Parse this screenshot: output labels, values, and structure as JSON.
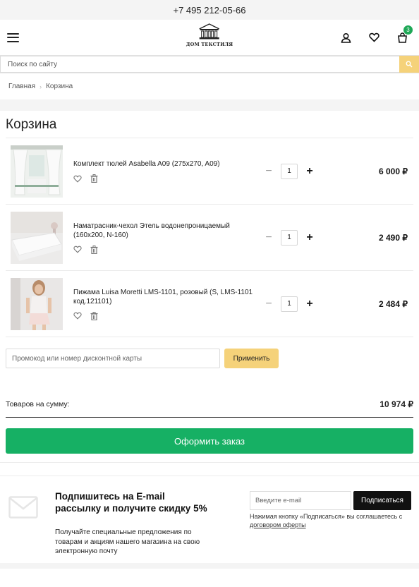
{
  "topbar": {
    "phone": "+7 495 212-05-66"
  },
  "header": {
    "logo_text": "ДОМ ТЕКСТИЛЯ",
    "cart_count": "3",
    "icons": [
      "menu-icon",
      "user-icon",
      "heart-icon",
      "cart-icon"
    ]
  },
  "search": {
    "placeholder": "Поиск по сайту"
  },
  "breadcrumb": {
    "home": "Главная",
    "separator": "›",
    "current": "Корзина"
  },
  "page": {
    "title": "Корзина"
  },
  "cart": {
    "items": [
      {
        "name": "Комплект тюлей Asabella A09 (275x270, A09)",
        "qty": "1",
        "price": "6 000 ₽"
      },
      {
        "name": "Наматрасник-чехол Этель водонепроницаемый (160x200, N-160)",
        "qty": "1",
        "price": "2 490 ₽"
      },
      {
        "name": "Пижама Luisa Moretti LMS-1101, розовый (S, LMS-1101 код.121101)",
        "qty": "1",
        "price": "2 484 ₽"
      }
    ],
    "minus_label": "−",
    "plus_label": "+"
  },
  "promo": {
    "placeholder": "Промокод или номер дисконтной карты",
    "button": "Применить"
  },
  "total": {
    "label": "Товаров на сумму:",
    "value": "10 974 ₽"
  },
  "checkout": {
    "button": "Оформить заказ"
  },
  "subscribe": {
    "title": "Подпишитесь на E-mail рассылку и получите скидку 5%",
    "description": "Получайте специальные предложения по товарам и акциям нашего магазина на свою электронную почту",
    "input_placeholder": "Введите e-mail",
    "button": "Подписаться",
    "note": "Нажимая кнопку «Подписаться» вы соглашаетесь с",
    "note_link": "договором оферты"
  },
  "colors": {
    "accent_green": "#16b064",
    "accent_yellow": "#f5d27a",
    "badge_green": "#1fa857"
  }
}
